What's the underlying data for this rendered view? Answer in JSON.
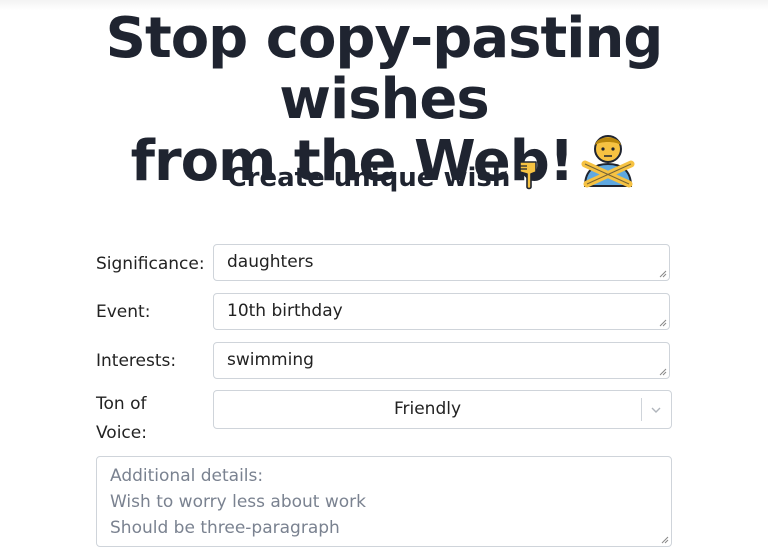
{
  "hero": {
    "title_line1": "Stop copy-pasting wishes",
    "title_line2": "from the Web!",
    "title_icon": "person-gesturing-no-icon"
  },
  "subtitle": {
    "text": "Create unique wish",
    "icon": "backhand-index-pointing-down-icon"
  },
  "form": {
    "significance": {
      "label": "Significance:",
      "value": "daughters"
    },
    "event": {
      "label": "Event:",
      "value": "10th birthday"
    },
    "interests": {
      "label": "Interests:",
      "value": "swimming"
    },
    "tone": {
      "label_line1": "Ton of",
      "label_line2": "Voice:",
      "value": "Friendly"
    },
    "details": {
      "placeholder_lines": [
        "Additional details:",
        "Wish to worry less about work",
        "Should be three-paragraph"
      ]
    }
  },
  "colors": {
    "text": "#1f2430",
    "border": "#cfd4da",
    "placeholder": "#7a8290",
    "emoji_skin": "#f6c242",
    "emoji_shirt": "#5fa8e0"
  }
}
